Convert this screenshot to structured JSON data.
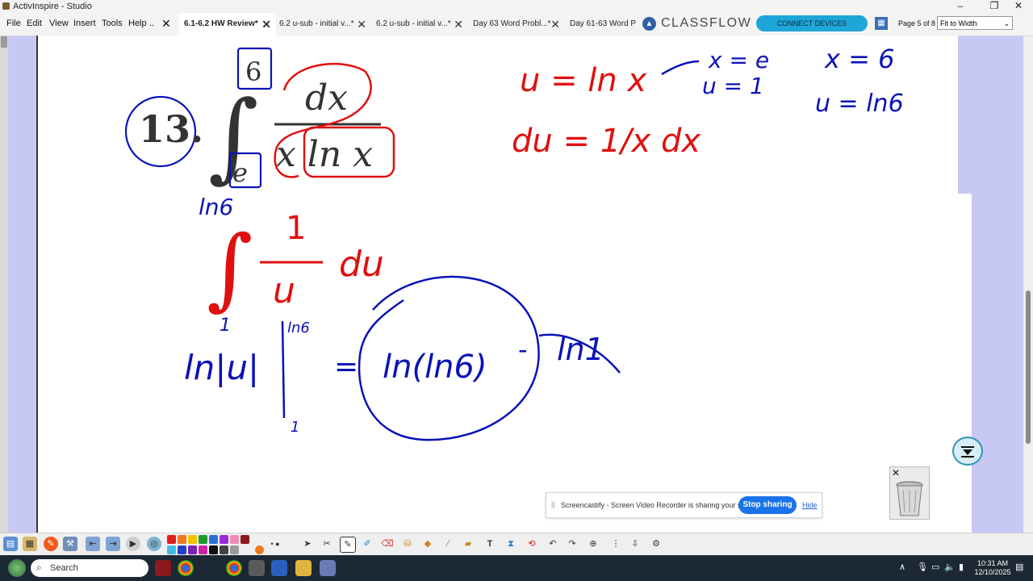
{
  "window": {
    "title": "ActivInspire - Studio",
    "minimize": "–",
    "restore": "❐",
    "close": "✕"
  },
  "menu": {
    "items": [
      "File",
      "Edit",
      "View",
      "Insert",
      "Tools",
      "Help",
      ".."
    ]
  },
  "tabs": [
    {
      "label": "6.1-6.2 HW Review*",
      "active": true
    },
    {
      "label": "6.2 u-sub - initial v...*",
      "active": false
    },
    {
      "label": "6.2 u-sub - initial v...*",
      "active": false
    },
    {
      "label": "Day 63 Word Probl...*",
      "active": false
    },
    {
      "label": "Day 61-63 Word P",
      "active": false
    }
  ],
  "tab_close": "✕",
  "classflow": {
    "logo": "▲",
    "text": "CLASSFLOW",
    "connect_label": "CONNECT DEVICES"
  },
  "paging": {
    "page_label": "Page 5 of 8",
    "zoom": "Fit to Width",
    "zoom_chevron": "⌄"
  },
  "flipchart": {
    "problem_number": "13.",
    "integral": {
      "upper": "6",
      "lower": "e",
      "numerator": "dx",
      "denominator": "x ln x",
      "sign": "∫"
    },
    "sub_u": "u = ln x",
    "sub_du": "du = 1/x dx",
    "lower_limit_x": "x = e",
    "lower_limit_u": "u = 1",
    "upper_limit_x": "x = 6",
    "upper_limit_u": "u = ln6",
    "new_integral": {
      "upper": "ln6",
      "lower": "1",
      "numerator": "1",
      "denominator": "u",
      "du": "du",
      "sign": "∫"
    },
    "antiderivative": "ln|u|",
    "eval_upper": "ln6",
    "eval_lower": "1",
    "eq": "=",
    "result_term": "ln(ln6)",
    "minus": "-",
    "crossed_term": "ln1"
  },
  "toast": {
    "message": "Screencastify - Screen Video Recorder is sharing your screen.",
    "stop_label": "Stop sharing",
    "hide_label": "Hide",
    "drag": "||"
  },
  "trash": {
    "close": "✕"
  },
  "toolbar_colors": [
    "#e0201b",
    "#f07a1b",
    "#f2c500",
    "#1a9a2d",
    "#2b6fd6",
    "#9b2bd6",
    "#f08bb3",
    "#8b1b1b",
    "#3dbde0",
    "#2340c8",
    "#7a1fb5",
    "#d01ea8",
    "#111111",
    "#444444",
    "#9a9a9a",
    "#f07a1b"
  ],
  "taskbar": {
    "search_label": "Search",
    "search_icon": "⌕",
    "tray_chevron": "∧",
    "clock_time": "10:31 AM",
    "clock_date": "12/10/2025"
  },
  "colors": {
    "ink_blue": "#0a12b8",
    "ink_red": "#e01010",
    "accent": "#1ea6d8"
  }
}
